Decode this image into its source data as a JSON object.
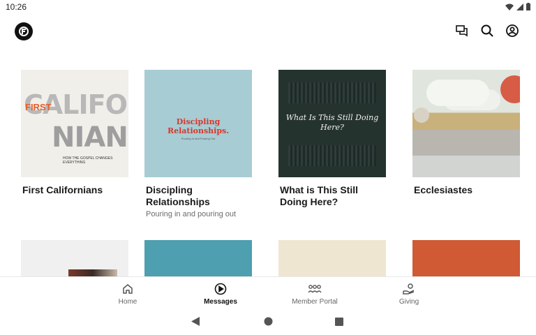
{
  "status": {
    "time": "10:26"
  },
  "app_bar": {
    "logo_icon": "church-logo-icon",
    "actions": [
      "chat-icon",
      "search-icon",
      "account-icon"
    ]
  },
  "series": [
    {
      "title": "First Californians",
      "subtitle": "",
      "art": {
        "big1": "CALIFOR",
        "big2": "NIANS",
        "first": "FIRST",
        "tag": "HOW THE GOSPEL CHANGES EVERYTHING"
      }
    },
    {
      "title": "Discipling Relationships",
      "subtitle": "Pouring in and pouring out",
      "art": {
        "heading": "Discipling Relationships.",
        "sub": "Pouring In and Pouring Out"
      }
    },
    {
      "title": "What is This Still Doing Here?",
      "subtitle": "",
      "art": {
        "heading": "What Is This Still Doing Here?"
      }
    },
    {
      "title": "Ecclesiastes",
      "subtitle": ""
    }
  ],
  "bottom_nav": {
    "items": [
      {
        "label": "Home",
        "icon": "home-icon",
        "active": false
      },
      {
        "label": "Messages",
        "icon": "play-circle-icon",
        "active": true
      },
      {
        "label": "Member Portal",
        "icon": "group-icon",
        "active": false
      },
      {
        "label": "Giving",
        "icon": "giving-hand-icon",
        "active": false
      }
    ]
  },
  "system_nav": [
    "back-icon",
    "home-circle-icon",
    "recents-icon"
  ],
  "colors": {
    "accent": "#111111",
    "muted_text": "#6b6b6b"
  }
}
